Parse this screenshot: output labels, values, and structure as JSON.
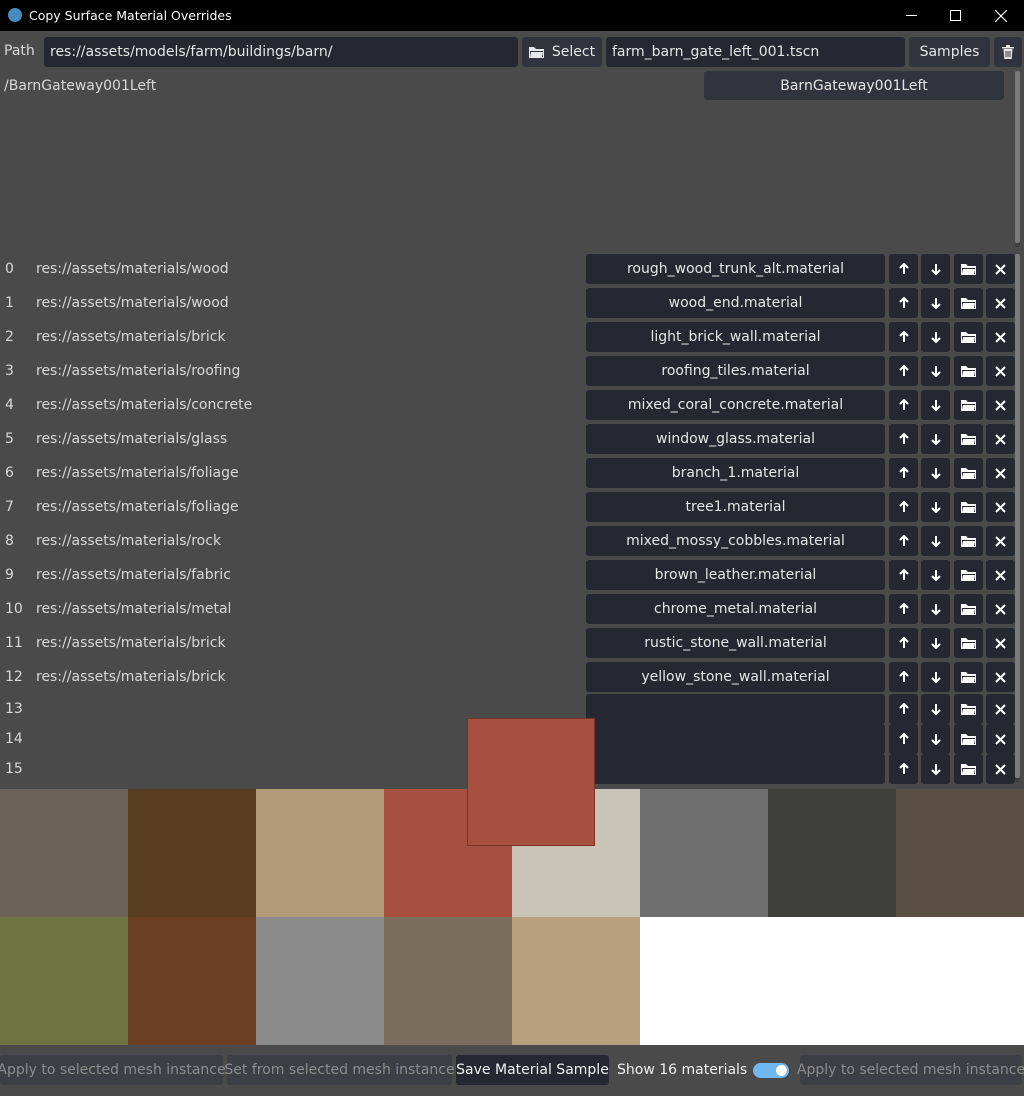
{
  "window": {
    "title": "Copy Surface Material Overrides",
    "controls": [
      "minimize-icon",
      "maximize-icon",
      "close-icon"
    ]
  },
  "toolbar": {
    "path_label": "Path",
    "path_value": "res://assets/models/farm/buildings/barn/",
    "select_label": "Select",
    "scene_file": "farm_barn_gate_left_001.tscn",
    "samples_label": "Samples",
    "delete_icon": "trash-icon"
  },
  "node": {
    "path": "/BarnGateway001Left",
    "button": "BarnGateway001Left"
  },
  "materials": [
    {
      "index": "0",
      "path": "res://assets/materials/wood",
      "file": "rough_wood_trunk_alt.material"
    },
    {
      "index": "1",
      "path": "res://assets/materials/wood",
      "file": "wood_end.material"
    },
    {
      "index": "2",
      "path": "res://assets/materials/brick",
      "file": "light_brick_wall.material"
    },
    {
      "index": "3",
      "path": "res://assets/materials/roofing",
      "file": "roofing_tiles.material"
    },
    {
      "index": "4",
      "path": "res://assets/materials/concrete",
      "file": "mixed_coral_concrete.material"
    },
    {
      "index": "5",
      "path": "res://assets/materials/glass",
      "file": "window_glass.material"
    },
    {
      "index": "6",
      "path": "res://assets/materials/foliage",
      "file": "branch_1.material"
    },
    {
      "index": "7",
      "path": "res://assets/materials/foliage",
      "file": "tree1.material"
    },
    {
      "index": "8",
      "path": "res://assets/materials/rock",
      "file": "mixed_mossy_cobbles.material"
    },
    {
      "index": "9",
      "path": "res://assets/materials/fabric",
      "file": "brown_leather.material"
    },
    {
      "index": "10",
      "path": "res://assets/materials/metal",
      "file": "chrome_metal.material"
    },
    {
      "index": "11",
      "path": "res://assets/materials/brick",
      "file": "rustic_stone_wall.material"
    },
    {
      "index": "12",
      "path": "res://assets/materials/brick",
      "file": "yellow_stone_wall.material"
    },
    {
      "index": "13",
      "path": "",
      "file": ""
    },
    {
      "index": "14",
      "path": "",
      "file": ""
    },
    {
      "index": "15",
      "path": "",
      "file": ""
    }
  ],
  "row_icons": [
    "arrow-up-icon",
    "arrow-down-icon",
    "folder-icon",
    "close-icon"
  ],
  "previews": [
    {
      "name": "wood-bark-preview",
      "color": "#6b6259"
    },
    {
      "name": "wood-end-preview",
      "color": "#5a3e22"
    },
    {
      "name": "light-brick-preview",
      "color": "#b39a78"
    },
    {
      "name": "roofing-tiles-preview",
      "color": "#a8503f"
    },
    {
      "name": "coral-concrete-preview",
      "color": "#c9c4b8"
    },
    {
      "name": "glass-preview",
      "color": "#6e6e6e"
    },
    {
      "name": "branch-preview",
      "color": "#3f4039"
    },
    {
      "name": "tree-preview",
      "color": "#5a4f42"
    },
    {
      "name": "mossy-cobbles-preview",
      "color": "#6f7443"
    },
    {
      "name": "leather-preview",
      "color": "#6c3e24"
    },
    {
      "name": "metal-preview",
      "color": "#8a8a8a"
    },
    {
      "name": "rustic-stone-preview",
      "color": "#7a6d5c"
    },
    {
      "name": "yellow-stone-preview",
      "color": "#b79f7f"
    }
  ],
  "bottom": {
    "apply_left": "Apply to selected mesh instance",
    "set_from": "Set from selected mesh instance",
    "save_sample": "Save Material Sample",
    "show_count": "Show 16 materials",
    "toggle_on": true,
    "apply_right": "Apply to selected mesh instance"
  },
  "colors": {
    "panel": "#4a4a4a",
    "field": "#252830",
    "toggle_accent": "#70b8f0"
  }
}
